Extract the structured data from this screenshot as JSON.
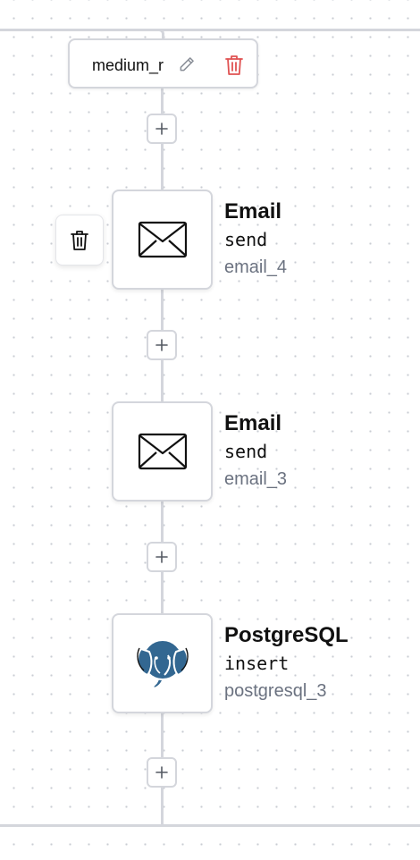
{
  "trigger": {
    "name": "medium_r",
    "edit_icon": "pencil-icon",
    "delete_icon": "trash-icon",
    "delete_color": "#e05252"
  },
  "add_step_icon": "plus-icon",
  "side_delete_icon": "trash-icon",
  "nodes": [
    {
      "title": "Email",
      "action": "send",
      "id": "email_4",
      "icon": "envelope-icon"
    },
    {
      "title": "Email",
      "action": "send",
      "id": "email_3",
      "icon": "envelope-icon"
    },
    {
      "title": "PostgreSQL",
      "action": "insert",
      "id": "postgresql_3",
      "icon": "postgresql-elephant-icon"
    }
  ],
  "colors": {
    "border": "#d4d6dc",
    "text_primary": "#111111",
    "text_secondary": "#6b7280",
    "postgres_blue": "#336791"
  }
}
